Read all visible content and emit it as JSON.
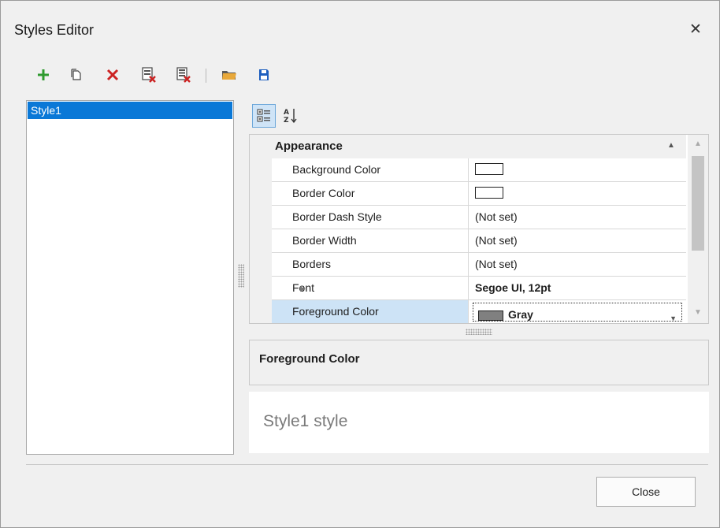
{
  "window": {
    "title": "Styles Editor",
    "close_glyph": "✕"
  },
  "toolbar": {
    "buttons": [
      {
        "name": "add-style-button",
        "icon": "plus-icon"
      },
      {
        "name": "copy-style-button",
        "icon": "copy-icon"
      },
      {
        "name": "delete-style-button",
        "icon": "delete-icon"
      },
      {
        "name": "remove-unused-button",
        "icon": "purge-icon"
      },
      {
        "name": "remove-all-button",
        "icon": "clear-all-icon"
      },
      {
        "name": "open-button",
        "icon": "folder-icon"
      },
      {
        "name": "save-button",
        "icon": "save-icon"
      }
    ]
  },
  "styles_list": {
    "items": [
      "Style1"
    ],
    "selected": "Style1"
  },
  "property_grid": {
    "toolbar": [
      "categorized-icon",
      "alphabetical-icon"
    ],
    "category": "Appearance",
    "rows": [
      {
        "name": "Background Color",
        "value": "",
        "swatch": "#ffffff"
      },
      {
        "name": "Border Color",
        "value": "",
        "swatch": "#ffffff"
      },
      {
        "name": "Border Dash Style",
        "value": "(Not set)"
      },
      {
        "name": "Border Width",
        "value": "(Not set)"
      },
      {
        "name": "Borders",
        "value": "(Not set)"
      },
      {
        "name": "Font",
        "value": "Segoe UI, 12pt",
        "expandable": true,
        "bold": true
      },
      {
        "name": "Foreground Color",
        "value": "Gray",
        "swatch": "#808080",
        "selected": true
      }
    ]
  },
  "description": {
    "title": "Foreground Color"
  },
  "preview": {
    "text": "Style1 style"
  },
  "footer": {
    "close_label": "Close"
  }
}
